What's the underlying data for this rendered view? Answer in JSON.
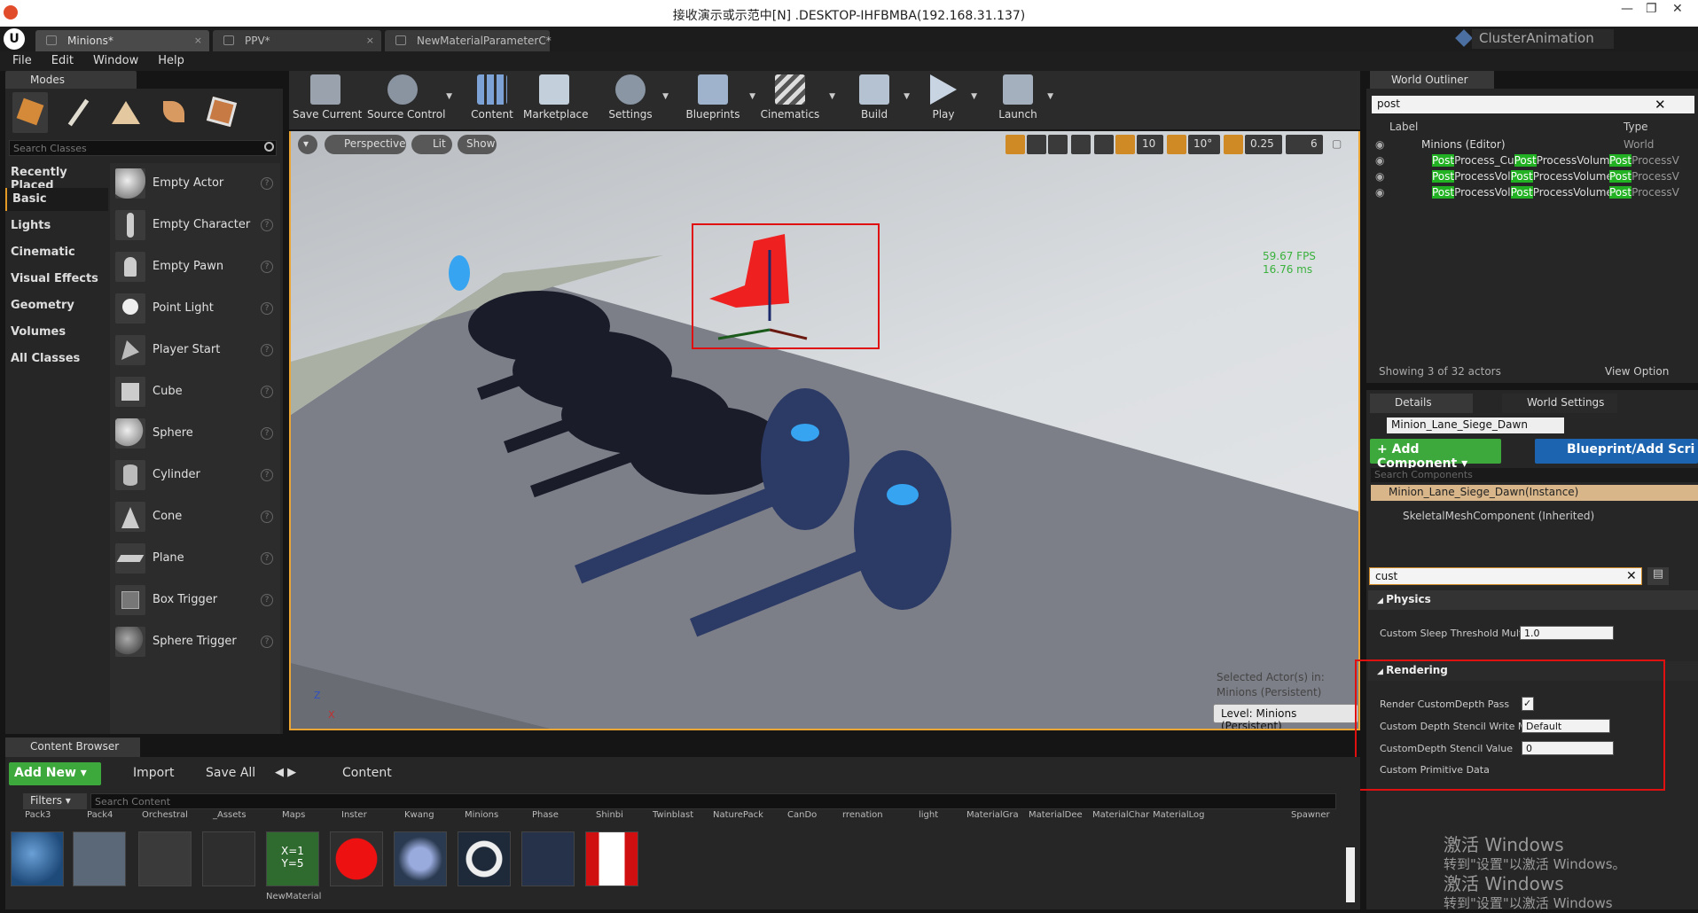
{
  "remote_title": "接收演示或示范中[N] .DESKTOP-IHFBMBA(192.168.31.137)",
  "window_controls": [
    "—",
    "❐",
    "✕"
  ],
  "doc_tabs": [
    {
      "label": "Minions*",
      "close": "×"
    },
    {
      "label": "PPV*",
      "close": "×"
    },
    {
      "label": "NewMaterialParameterC*",
      "close": "×"
    }
  ],
  "project_name": "ClusterAnimation",
  "menu": [
    "File",
    "Edit",
    "Window",
    "Help"
  ],
  "modes": {
    "tab_label": "Modes",
    "search_placeholder": "Search Classes",
    "categories": [
      "Recently Placed",
      "Basic",
      "Lights",
      "Cinematic",
      "Visual Effects",
      "Geometry",
      "Volumes",
      "All Classes"
    ],
    "selected_category": "Basic",
    "items": [
      "Empty Actor",
      "Empty Character",
      "Empty Pawn",
      "Point Light",
      "Player Start",
      "Cube",
      "Sphere",
      "Cylinder",
      "Cone",
      "Plane",
      "Box Trigger",
      "Sphere Trigger"
    ]
  },
  "toolbar": [
    "Save Current",
    "Source Control",
    "Content",
    "Marketplace",
    "Settings",
    "Blueprints",
    "Cinematics",
    "Build",
    "Play",
    "Launch"
  ],
  "viewport": {
    "perspective": "Perspective",
    "lit": "Lit",
    "show": "Show",
    "grid_snap": "10",
    "rot_snap": "10°",
    "scale_snap": "0.25",
    "cam_speed": "6",
    "fps": "59.67 FPS",
    "ms": "16.76 ms",
    "selected_line1": "Selected Actor(s) in:",
    "selected_line2": "Minions (Persistent)",
    "level": "Level:  Minions (Persistent)",
    "axis_z": "Z",
    "axis_x": "X"
  },
  "outliner": {
    "tab_label": "World Outliner",
    "search_value": "post",
    "col_label": "Label",
    "col_type": "Type",
    "root": {
      "label": "Minions (Editor)",
      "type": "World"
    },
    "rows": [
      {
        "pre": "Post",
        "mid": "Process_Cu",
        "hl2": "Post",
        "rest": "ProcessVolume",
        "type_hl": "Post",
        "type_rest": "ProcessV"
      },
      {
        "pre": "Post",
        "mid": "ProcessVol",
        "hl2": "Post",
        "rest": "ProcessVolume",
        "type_hl": "Post",
        "type_rest": "ProcessV"
      },
      {
        "pre": "Post",
        "mid": "ProcessVol",
        "hl2": "Post",
        "rest": "ProcessVolume",
        "type_hl": "Post",
        "type_rest": "ProcessV"
      }
    ],
    "count": "Showing 3 of 32 actors",
    "view_options": "View Option"
  },
  "details": {
    "tab_label": "Details",
    "tab_world": "World Settings",
    "actor_name": "Minion_Lane_Siege_Dawn",
    "add_component": "+ Add Component ▾",
    "blueprint_add": "Blueprint/Add Scri",
    "search_components": "Search Components",
    "component_root": "Minion_Lane_Siege_Dawn(Instance)",
    "component_child": "SkeletalMeshComponent (Inherited)",
    "search_value": "cust",
    "physics_header": "Physics",
    "physics_prop": "Custom Sleep Threshold Multi",
    "physics_val": "1.0",
    "rendering_header": "Rendering",
    "props": [
      {
        "label": "Render CustomDepth Pass",
        "value": "✓"
      },
      {
        "label": "Custom Depth Stencil Write Ma",
        "value": "Default"
      },
      {
        "label": "CustomDepth Stencil Value",
        "value": "0"
      },
      {
        "label": "Custom Primitive Data",
        "value": ""
      }
    ]
  },
  "watermark": {
    "line1": "激活 Windows",
    "line2": "转到\"设置\"以激活 Windows。",
    "line3": "激活 Windows",
    "line4": "转到\"设置\"以激活 Windows"
  },
  "content_browser": {
    "tab_label": "Content Browser",
    "add_new": "Add New ▾",
    "import": "Import",
    "save_all": "Save All",
    "path": "Content",
    "filters": "Filters ▾",
    "search_placeholder": "Search Content",
    "folders": [
      "Pack3",
      "Pack4",
      "Orchestral",
      "_Assets",
      "Maps",
      "Inster",
      "Kwang",
      "Minions",
      "Phase",
      "Shinbi",
      "Twinblast",
      "NaturePack",
      "CanDo",
      "rrenation",
      "light",
      "MaterialGra",
      "MaterialDee",
      "MaterialChar",
      "MaterialLog",
      "Spawner"
    ],
    "asset_label": "NewMaterial"
  }
}
